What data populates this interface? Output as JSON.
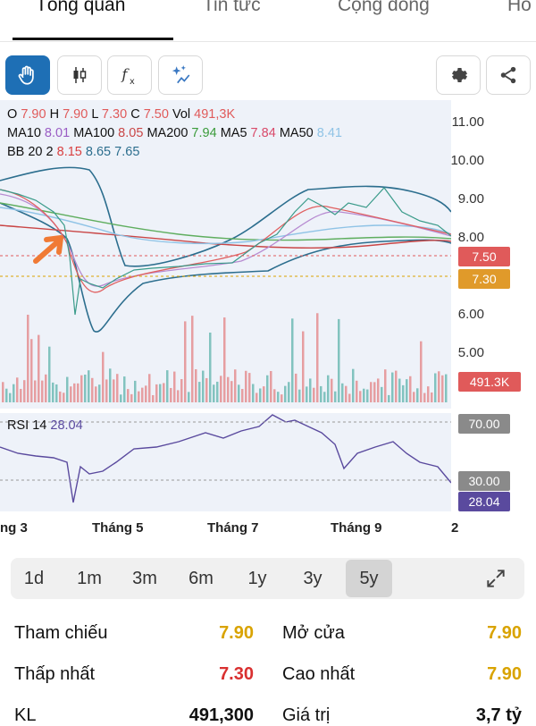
{
  "tabs": [
    "Tổng quan",
    "Tin tức",
    "Cộng đồng",
    "Hồ"
  ],
  "legend": {
    "o_label": "O",
    "o_val": "7.90",
    "h_label": "H",
    "h_val": "7.90",
    "l_label": "L",
    "l_val": "7.30",
    "c_label": "C",
    "c_val": "7.50",
    "vol_label": "Vol",
    "vol_val": "491,3K",
    "ma10_label": "MA10",
    "ma10_val": "8.01",
    "ma100_label": "MA100",
    "ma100_val": "8.05",
    "ma200_label": "MA200",
    "ma200_val": "7.94",
    "ma5_label": "MA5",
    "ma5_val": "7.84",
    "ma50_label": "MA50",
    "ma50_val": "8.41",
    "bb_label": "BB 20 2",
    "bb_v1": "8.15",
    "bb_v2": "8.65",
    "bb_v3": "7.65"
  },
  "price_axis": [
    "11.00",
    "10.00",
    "9.00",
    "8.00",
    "6.00",
    "5.00"
  ],
  "badges": {
    "close": "7.50",
    "low": "7.30",
    "volume": "491.3K",
    "rsi_high": "70.00",
    "rsi_low": "30.00",
    "rsi_val": "28.04"
  },
  "rsi": {
    "label": "RSI 14",
    "value": "28.04"
  },
  "x_axis": [
    "ng 3",
    "Tháng 5",
    "Tháng 7",
    "Tháng 9",
    "2"
  ],
  "periods": [
    "1d",
    "1m",
    "3m",
    "6m",
    "1y",
    "3y",
    "5y"
  ],
  "active_period": "5y",
  "stats": {
    "tham_chieu_label": "Tham chiếu",
    "tham_chieu": "7.90",
    "mo_cua_label": "Mở cửa",
    "mo_cua": "7.90",
    "thap_nhat_label": "Thấp nhất",
    "thap_nhat": "7.30",
    "cao_nhat_label": "Cao nhất",
    "cao_nhat": "7.90",
    "kl_label": "KL",
    "kl": "491,300",
    "gia_tri_label": "Giá trị",
    "gia_tri": "3,7 tỷ"
  },
  "colors": {
    "up": "#2a9d8f",
    "down": "#e05a5a",
    "accent": "#1e6fb5",
    "yellow": "#d9a300"
  },
  "icons": [
    "hand-icon",
    "candlestick-icon",
    "function-icon",
    "sparkle-icon",
    "gear-icon",
    "share-icon",
    "expand-icon"
  ]
}
